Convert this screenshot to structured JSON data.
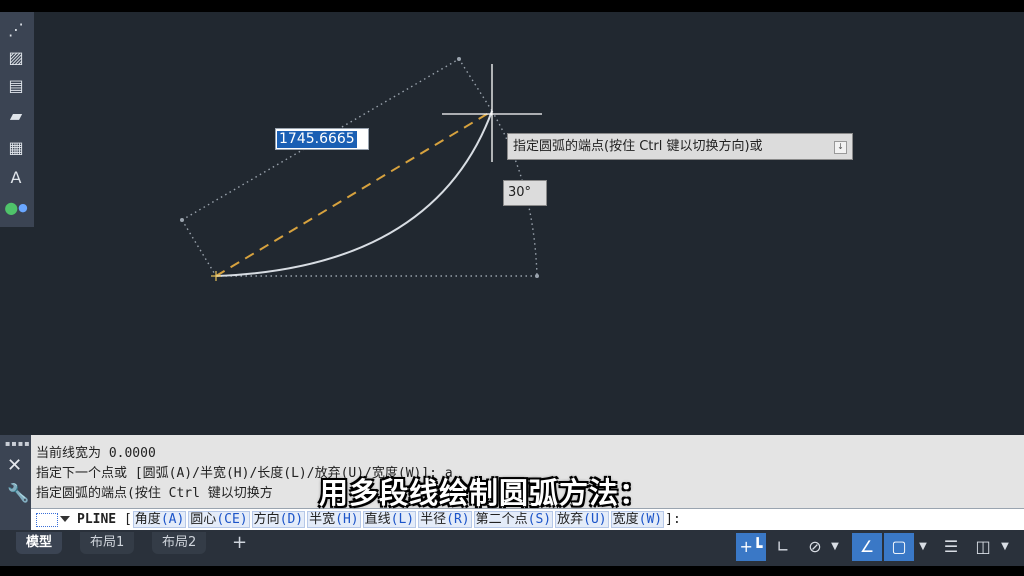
{
  "canvas": {
    "dynamic_input_value": "1745.6665",
    "tooltip_text": "指定圆弧的端点(按住 Ctrl 键以切换方向)或",
    "angle_value": "30°"
  },
  "command": {
    "history": [
      "当前线宽为 0.0000",
      "指定下一个点或 [圆弧(A)/半宽(H)/长度(L)/放弃(U)/宽度(W)]: a",
      "指定圆弧的端点(按住 Ctrl 键以切换方"
    ],
    "prompt_command": "PLINE",
    "prompt_open": "[",
    "prompt_close": "]:",
    "options": [
      {
        "label": "角度",
        "key": "(A)"
      },
      {
        "label": "圆心",
        "key": "(CE)"
      },
      {
        "label": "方向",
        "key": "(D)"
      },
      {
        "label": "半宽",
        "key": "(H)"
      },
      {
        "label": "直线",
        "key": "(L)"
      },
      {
        "label": "半径",
        "key": "(R)"
      },
      {
        "label": "第二个点",
        "key": "(S)"
      },
      {
        "label": "放弃",
        "key": "(U)"
      },
      {
        "label": "宽度",
        "key": "(W)"
      }
    ]
  },
  "subtitle": "用多段线绘制圆弧方法：",
  "tabs": [
    "模型",
    "布局1",
    "布局2",
    "+"
  ],
  "colors": {
    "canvas_bg": "#212830",
    "arc": "#d8dde3",
    "dashed_chord": "#d7a23e",
    "selection_blue": "#1a5fb4",
    "status_active": "#3a78c6"
  },
  "icons": {
    "toolbar": [
      "point-icon",
      "hatch-icon",
      "gradient-icon",
      "block-icon",
      "table-icon",
      "text-icon",
      "group-icon"
    ],
    "status": [
      "ortho-snap-icon",
      "polar-tracking-icon",
      "isodraft-icon",
      "dropdown-icon",
      "dynamic-input-icon",
      "object-snap-icon",
      "dropdown-icon",
      "lineweight-icon",
      "3d-view-icon",
      "dropdown-icon"
    ]
  }
}
